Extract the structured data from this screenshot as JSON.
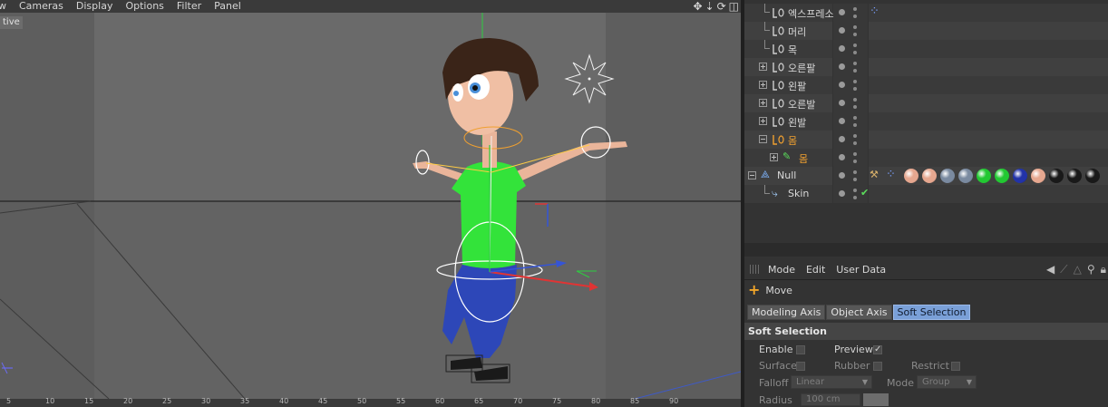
{
  "viewport": {
    "menus": [
      "w",
      "Cameras",
      "Display",
      "Options",
      "Filter",
      "Panel"
    ],
    "view_label": "tive",
    "nav_icons": [
      "move-icon",
      "zoom-icon",
      "rotate-icon",
      "maximize-icon"
    ],
    "ruler_labels": [
      "5",
      "10",
      "15",
      "20",
      "25",
      "30",
      "35",
      "40",
      "45",
      "50",
      "55",
      "60",
      "65",
      "70",
      "75",
      "80",
      "85",
      "90"
    ]
  },
  "object_manager": {
    "objects": [
      {
        "name": "엑스프레소",
        "kind": "joint",
        "level": 1,
        "expander": "none",
        "highlight": false,
        "vis": "dots",
        "tags": [
          "dots-tag"
        ]
      },
      {
        "name": "머리",
        "kind": "joint",
        "level": 1,
        "expander": "none",
        "highlight": false,
        "vis": "dots",
        "tags": []
      },
      {
        "name": "목",
        "kind": "joint",
        "level": 1,
        "expander": "none",
        "highlight": false,
        "vis": "dots",
        "tags": []
      },
      {
        "name": "오른팔",
        "kind": "joint",
        "level": 1,
        "expander": "plus",
        "highlight": false,
        "vis": "dots",
        "tags": []
      },
      {
        "name": "왼팔",
        "kind": "joint",
        "level": 1,
        "expander": "plus",
        "highlight": false,
        "vis": "dots",
        "tags": []
      },
      {
        "name": "오른발",
        "kind": "joint",
        "level": 1,
        "expander": "plus",
        "highlight": false,
        "vis": "dots",
        "tags": []
      },
      {
        "name": "왼발",
        "kind": "joint",
        "level": 1,
        "expander": "plus",
        "highlight": false,
        "vis": "dots",
        "tags": []
      },
      {
        "name": "몸",
        "kind": "joint",
        "level": 1,
        "expander": "minus",
        "highlight": true,
        "vis": "dots",
        "tags": []
      },
      {
        "name": "몸",
        "kind": "bone",
        "level": 2,
        "expander": "plus",
        "highlight": true,
        "vis": "dots",
        "tags": []
      },
      {
        "name": "Null",
        "kind": "null",
        "level": 0,
        "expander": "minus",
        "highlight": false,
        "vis": "dots",
        "tags": [
          "phong-tag",
          "dots-tag",
          "skin-mat",
          "skin-mat",
          "eye-mat",
          "eye-mat",
          "green-mat",
          "green-mat",
          "blue-mat",
          "skin-mat",
          "black-mat",
          "black-mat",
          "black-mat"
        ]
      },
      {
        "name": "Skin",
        "kind": "skin",
        "level": 1,
        "expander": "none",
        "highlight": false,
        "vis": "check",
        "tags": []
      }
    ],
    "material_colors": {
      "skin-mat": "#e6a78f",
      "eye-mat": "#7a8aa0",
      "green-mat": "#22c832",
      "blue-mat": "#2233a8",
      "black-mat": "#191919"
    },
    "highlight_color": "#f0a030"
  },
  "attribute_manager": {
    "menus": [
      "Mode",
      "Edit",
      "User Data"
    ],
    "tool_icons": [
      "arrow-left-icon",
      "arrow-up-icon",
      "arrow-right-icon",
      "search-icon",
      "lock-icon"
    ],
    "tool_name": "Move",
    "tabs": [
      {
        "label": "Modeling Axis",
        "active": false
      },
      {
        "label": "Object Axis",
        "active": false
      },
      {
        "label": "Soft Selection",
        "active": true
      }
    ],
    "section_title": "Soft Selection",
    "fields": {
      "enable_label": "Enable",
      "enable_checked": false,
      "preview_label": "Preview",
      "preview_checked": true,
      "surface_label": "Surface",
      "rubber_label": "Rubber",
      "restrict_label": "Restrict",
      "falloff_label": "Falloff",
      "falloff_value": "Linear",
      "mode_label": "Mode",
      "mode_value": "Group",
      "radius_label": "Radius",
      "radius_value": "100 cm"
    }
  }
}
